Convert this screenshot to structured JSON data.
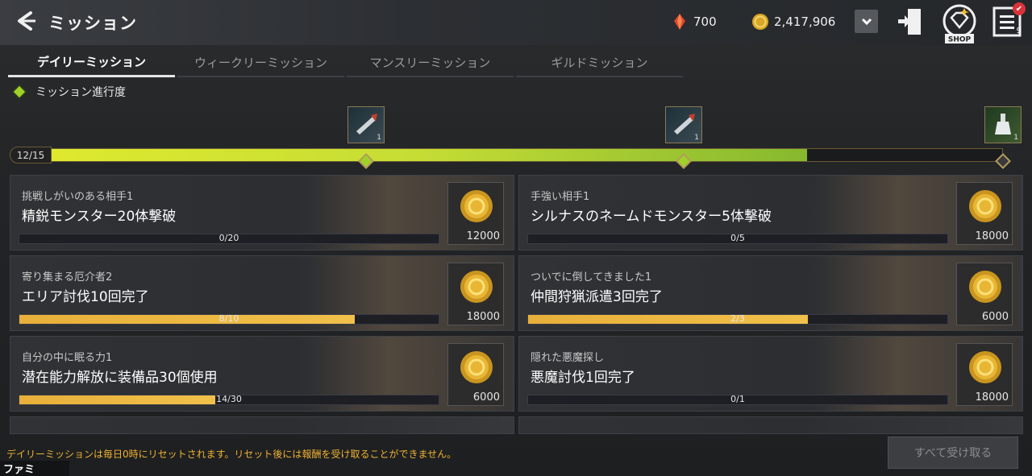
{
  "header": {
    "title": "ミッション",
    "gem_count": "700",
    "gold_count": "2,417,906",
    "shop_label": "SHOP",
    "menu_badge": "✔",
    "menu_count": "9"
  },
  "tabs": [
    {
      "label": "デイリーミッション",
      "active": true
    },
    {
      "label": "ウィークリーミッション",
      "active": false
    },
    {
      "label": "マンスリーミッション",
      "active": false
    },
    {
      "label": "ギルドミッション",
      "active": false
    }
  ],
  "progress": {
    "label": "ミッション進行度",
    "counter": "12/15",
    "value": 12,
    "max": 15,
    "rewards": [
      {
        "count": "1"
      },
      {
        "count": "1"
      },
      {
        "count": "1"
      }
    ]
  },
  "missions": [
    {
      "subtitle": "挑戦しがいのある相手1",
      "title": "精鋭モンスター20体撃破",
      "progress_text": "0/20",
      "progress": 0.0,
      "reward": "12000"
    },
    {
      "subtitle": "手強い相手1",
      "title": "シルナスのネームドモンスター5体撃破",
      "progress_text": "0/5",
      "progress": 0.0,
      "reward": "18000"
    },
    {
      "subtitle": "寄り集まる厄介者2",
      "title": "エリア討伐10回完了",
      "progress_text": "8/10",
      "progress": 0.8,
      "reward": "18000"
    },
    {
      "subtitle": "ついでに倒してきました1",
      "title": "仲間狩猟派遣3回完了",
      "progress_text": "2/3",
      "progress": 0.667,
      "reward": "6000"
    },
    {
      "subtitle": "自分の中に眠る力1",
      "title": "潜在能力解放に装備品30個使用",
      "progress_text": "14/30",
      "progress": 0.467,
      "reward": "6000"
    },
    {
      "subtitle": "隠れた悪魔探し",
      "title": "悪魔討伐1回完了",
      "progress_text": "0/1",
      "progress": 0.0,
      "reward": "18000"
    }
  ],
  "footer": {
    "note": "デイリーミッションは毎日0時にリセットされます。リセット後には報酬を受け取ることができません。",
    "claim_all": "すべて受け取る",
    "watermark": "ファミ通.com"
  }
}
